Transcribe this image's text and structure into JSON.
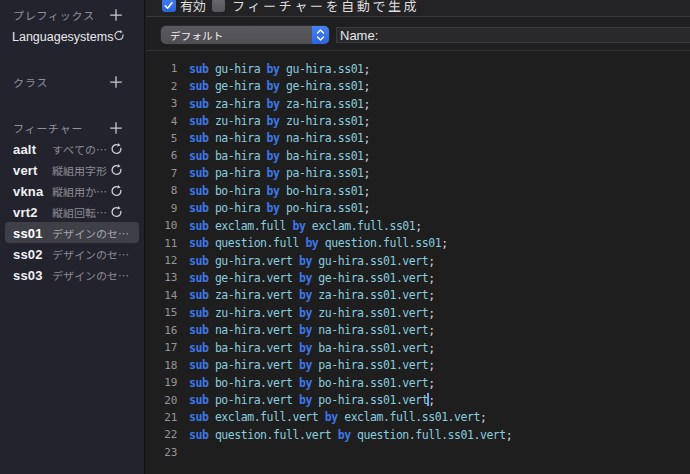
{
  "toolbar": {
    "enabled_checkbox": {
      "label": "有効",
      "checked": true
    },
    "auto_generate_checkbox": {
      "label": "フィーチャーを自動で生成",
      "checked": false
    }
  },
  "params": {
    "dropdown": {
      "selected": "デフォルト"
    },
    "name_field": {
      "label": "Name:",
      "value": ""
    }
  },
  "sidebar": {
    "prefix_section": {
      "title": "プレフィックス",
      "items": [
        {
          "name": "Languagesystems",
          "refresh": true
        }
      ]
    },
    "class_section": {
      "title": "クラス"
    },
    "feature_section": {
      "title": "フィーチャー",
      "items": [
        {
          "tag": "aalt",
          "desc": "すべての…",
          "refresh": true,
          "selected": false
        },
        {
          "tag": "vert",
          "desc": "縦組用字形",
          "refresh": true,
          "selected": false
        },
        {
          "tag": "vkna",
          "desc": "縦組用か…",
          "refresh": true,
          "selected": false
        },
        {
          "tag": "vrt2",
          "desc": "縦組回転…",
          "refresh": true,
          "selected": false
        },
        {
          "tag": "ss01",
          "desc": "デザインのセ…",
          "refresh": false,
          "selected": true
        },
        {
          "tag": "ss02",
          "desc": "デザインのセ…",
          "refresh": false,
          "selected": false
        },
        {
          "tag": "ss03",
          "desc": "デザインのセ…",
          "refresh": false,
          "selected": false
        }
      ]
    }
  },
  "editor": {
    "caret_line": 20,
    "keywords": [
      "sub",
      "by"
    ],
    "lines": [
      "sub gu-hira by gu-hira.ss01;",
      "sub ge-hira by ge-hira.ss01;",
      "sub za-hira by za-hira.ss01;",
      "sub zu-hira by zu-hira.ss01;",
      "sub na-hira by na-hira.ss01;",
      "sub ba-hira by ba-hira.ss01;",
      "sub pa-hira by pa-hira.ss01;",
      "sub bo-hira by bo-hira.ss01;",
      "sub po-hira by po-hira.ss01;",
      "sub exclam.full by exclam.full.ss01;",
      "sub question.full by question.full.ss01;",
      "sub gu-hira.vert by gu-hira.ss01.vert;",
      "sub ge-hira.vert by ge-hira.ss01.vert;",
      "sub za-hira.vert by za-hira.ss01.vert;",
      "sub zu-hira.vert by zu-hira.ss01.vert;",
      "sub na-hira.vert by na-hira.ss01.vert;",
      "sub ba-hira.vert by ba-hira.ss01.vert;",
      "sub pa-hira.vert by pa-hira.ss01.vert;",
      "sub bo-hira.vert by bo-hira.ss01.vert;",
      "sub po-hira.vert by po-hira.ss01.vert;",
      "sub exclam.full.vert by exclam.full.ss01.vert;",
      "sub question.full.vert by question.full.ss01.vert;",
      ""
    ],
    "colors": {
      "keyword": "#3d76e8",
      "identifier": "#8accdf",
      "punctuation": "#d4d4d6",
      "line_number": "#95959a",
      "caret": "#7ba2f0"
    }
  }
}
